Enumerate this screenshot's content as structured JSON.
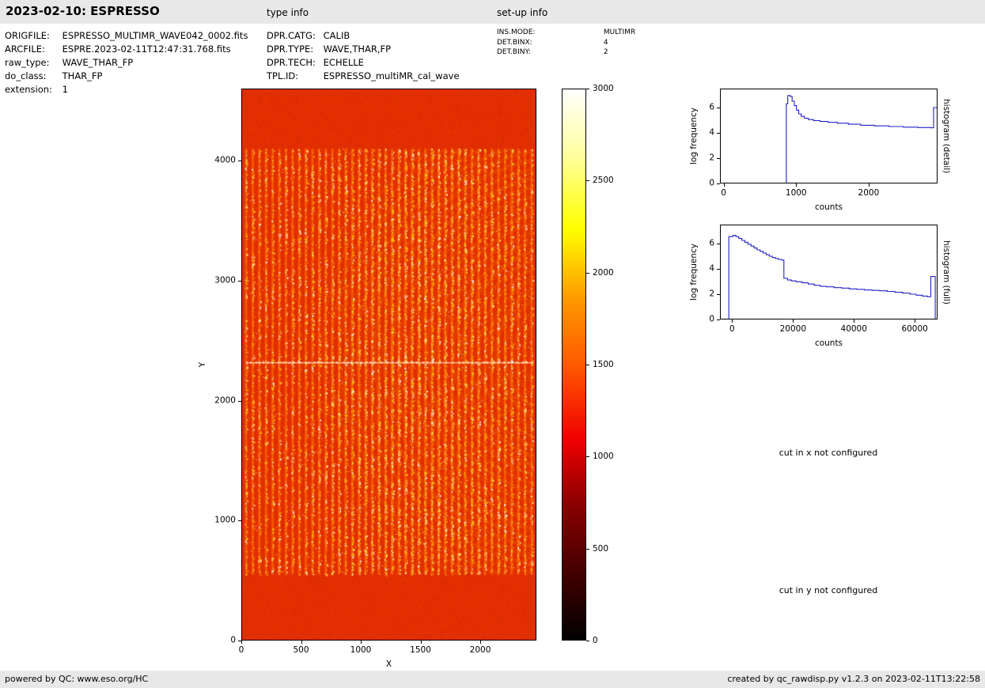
{
  "header": {
    "title": "2023-02-10: ESPRESSO",
    "type_info_label": "type info",
    "setup_info_label": "set-up info"
  },
  "file_info": {
    "rows": [
      {
        "label": "ORIGFILE:",
        "value": "ESPRESSO_MULTIMR_WAVE042_0002.fits"
      },
      {
        "label": "ARCFILE:",
        "value": "ESPRE.2023-02-11T12:47:31.768.fits"
      },
      {
        "label": "raw_type:",
        "value": "WAVE_THAR_FP"
      },
      {
        "label": "do_class:",
        "value": "THAR_FP"
      },
      {
        "label": "extension:",
        "value": "1"
      }
    ]
  },
  "type_info": {
    "rows": [
      {
        "label": "DPR.CATG:",
        "value": "CALIB"
      },
      {
        "label": "DPR.TYPE:",
        "value": "WAVE,THAR,FP"
      },
      {
        "label": "DPR.TECH:",
        "value": "ECHELLE"
      },
      {
        "label": "TPL.ID:",
        "value": "ESPRESSO_multiMR_cal_wave"
      }
    ]
  },
  "setup_info": {
    "rows": [
      {
        "label": "INS.MODE:",
        "value": "MULTIMR"
      },
      {
        "label": "DET.BINX:",
        "value": "4"
      },
      {
        "label": "DET.BINY:",
        "value": "2"
      }
    ]
  },
  "messages": {
    "cut_x": "cut in x not configured",
    "cut_y": "cut in y not configured"
  },
  "footer": {
    "left": "powered by QC: www.eso.org/HC",
    "right": "created by qc_rawdisp.py v1.2.3 on 2023-02-11T13:22:58"
  },
  "chart_data": [
    {
      "type": "heatmap",
      "name": "raw detector image (echelle order stripes, hot colormap)",
      "xlabel": "X",
      "ylabel": "Y",
      "xlim": [
        0,
        2470
      ],
      "ylim": [
        0,
        4600
      ],
      "xticks": [
        0,
        500,
        1000,
        1500,
        2000
      ],
      "yticks": [
        0,
        1000,
        2000,
        3000,
        4000
      ],
      "colorbar": {
        "range": [
          0,
          3000
        ],
        "ticks": [
          0,
          500,
          1000,
          1500,
          2000,
          2500,
          3000
        ],
        "stops": [
          {
            "pos": 0,
            "color": "#000000"
          },
          {
            "pos": 0.12,
            "color": "#420000"
          },
          {
            "pos": 0.25,
            "color": "#8c0000"
          },
          {
            "pos": 0.365,
            "color": "#f10000"
          },
          {
            "pos": 0.5,
            "color": "#ff5a00"
          },
          {
            "pos": 0.62,
            "color": "#ff9a00"
          },
          {
            "pos": 0.746,
            "color": "#ffff00"
          },
          {
            "pos": 0.88,
            "color": "#ffffa0"
          },
          {
            "pos": 1,
            "color": "#ffffff"
          }
        ]
      },
      "render": {
        "seed": 1337,
        "background_color": "#e22e00",
        "noise_dark": "#c02000",
        "noise_light": "#ff5a00",
        "stripe_color": "#ff6a00",
        "dot_colors": [
          "#ffd400",
          "#ffef80",
          "#ffb300",
          "#ffffff"
        ],
        "n_stripes": 44,
        "stripe_x_range": [
          40,
          2430
        ],
        "stripe_y_range": [
          550,
          4100
        ],
        "bright_line_y": 2320,
        "line_color_row": "#ffd9a0",
        "arc_color": "#ffc800"
      }
    },
    {
      "type": "line",
      "name": "histogram (detail)",
      "xlabel": "counts",
      "ylabel": "log frequency",
      "right_label": "histogram (detail)",
      "xlim": [
        -50,
        2950
      ],
      "ylim": [
        0,
        7.5
      ],
      "xticks": [
        0,
        1000,
        2000
      ],
      "yticks": [
        0,
        2,
        4,
        6
      ],
      "line_color": "#2020cc",
      "step": true,
      "points": [
        [
          865,
          6.3
        ],
        [
          885,
          6.95
        ],
        [
          920,
          6.88
        ],
        [
          945,
          6.5
        ],
        [
          975,
          6.15
        ],
        [
          1005,
          5.8
        ],
        [
          1035,
          5.5
        ],
        [
          1070,
          5.3
        ],
        [
          1115,
          5.15
        ],
        [
          1170,
          5.05
        ],
        [
          1240,
          4.97
        ],
        [
          1330,
          4.9
        ],
        [
          1440,
          4.83
        ],
        [
          1570,
          4.76
        ],
        [
          1720,
          4.68
        ],
        [
          1890,
          4.6
        ],
        [
          2080,
          4.55
        ],
        [
          2280,
          4.5
        ],
        [
          2480,
          4.45
        ],
        [
          2680,
          4.42
        ],
        [
          2850,
          4.4
        ],
        [
          2895,
          6.0
        ],
        [
          2950,
          6.0
        ]
      ]
    },
    {
      "type": "line",
      "name": "histogram (full)",
      "xlabel": "counts",
      "ylabel": "log frequency",
      "right_label": "histogram (full)",
      "xlim": [
        -4000,
        67500
      ],
      "ylim": [
        0,
        7.5
      ],
      "xticks": [
        0,
        20000,
        40000,
        60000
      ],
      "yticks": [
        0,
        2,
        4,
        6
      ],
      "line_color": "#2020cc",
      "step": true,
      "points": [
        [
          -1100,
          6.55
        ],
        [
          300,
          6.65
        ],
        [
          1200,
          6.55
        ],
        [
          2200,
          6.4
        ],
        [
          3200,
          6.25
        ],
        [
          4200,
          6.1
        ],
        [
          5200,
          5.95
        ],
        [
          6200,
          5.8
        ],
        [
          7200,
          5.65
        ],
        [
          8200,
          5.5
        ],
        [
          9200,
          5.38
        ],
        [
          10200,
          5.25
        ],
        [
          11200,
          5.12
        ],
        [
          12200,
          5.0
        ],
        [
          13200,
          4.9
        ],
        [
          14200,
          4.82
        ],
        [
          15200,
          4.75
        ],
        [
          16200,
          4.7
        ],
        [
          17000,
          3.25
        ],
        [
          18200,
          3.12
        ],
        [
          19500,
          3.05
        ],
        [
          21000,
          2.98
        ],
        [
          23000,
          2.9
        ],
        [
          25000,
          2.8
        ],
        [
          27000,
          2.7
        ],
        [
          29000,
          2.62
        ],
        [
          31000,
          2.58
        ],
        [
          33500,
          2.52
        ],
        [
          36000,
          2.48
        ],
        [
          38500,
          2.42
        ],
        [
          41000,
          2.38
        ],
        [
          43500,
          2.33
        ],
        [
          46000,
          2.3
        ],
        [
          48500,
          2.27
        ],
        [
          51000,
          2.22
        ],
        [
          53500,
          2.15
        ],
        [
          56000,
          2.08
        ],
        [
          58500,
          2.0
        ],
        [
          60500,
          1.92
        ],
        [
          62500,
          1.85
        ],
        [
          64200,
          1.8
        ],
        [
          65300,
          3.4
        ],
        [
          66700,
          3.4
        ],
        [
          66750,
          0
        ]
      ]
    }
  ]
}
